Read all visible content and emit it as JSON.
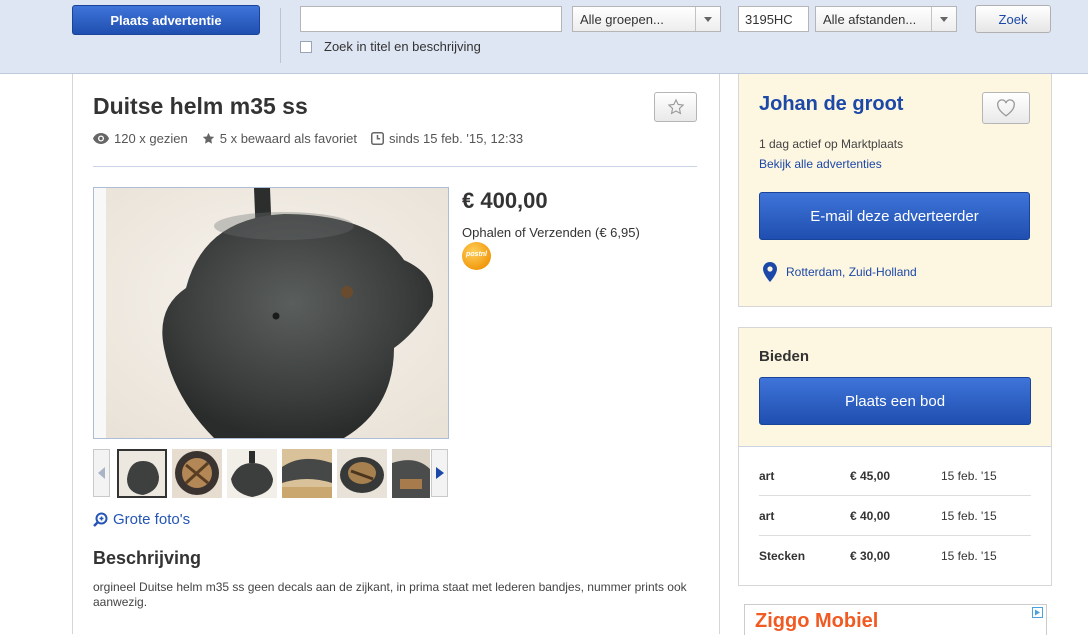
{
  "header": {
    "place_ad": "Plaats advertentie",
    "search_value": "",
    "groups_select": "Alle groepen...",
    "postcode": "3195HC",
    "distance_select": "Alle afstanden...",
    "search_button": "Zoek",
    "search_in_description": "Zoek in titel en beschrijving"
  },
  "listing": {
    "title": "Duitse helm m35 ss",
    "views": "120 x gezien",
    "favorites": "5 x bewaard als favoriet",
    "since": "sinds 15 feb. '15, 12:33",
    "price": "€ 400,00",
    "delivery": "Ophalen of Verzenden (€ 6,95)",
    "postnl_logo": "postnl",
    "large_photos": "Grote foto's",
    "description_heading": "Beschrijving",
    "description": "orgineel Duitse helm m35 ss geen decals aan de zijkant, in prima staat met lederen bandjes, nummer prints ook aanwezig."
  },
  "seller": {
    "name": "Johan de groot",
    "active": "1 dag actief op Marktplaats",
    "all_ads": "Bekijk alle advertenties",
    "email_button": "E-mail deze adverteerder",
    "location": "Rotterdam, Zuid-Holland"
  },
  "bids": {
    "heading": "Bieden",
    "button": "Plaats een bod",
    "rows": [
      {
        "name": "art",
        "amount": "€ 45,00",
        "date": "15 feb. '15"
      },
      {
        "name": "art",
        "amount": "€ 40,00",
        "date": "15 feb. '15"
      },
      {
        "name": "Stecken",
        "amount": "€ 30,00",
        "date": "15 feb. '15"
      }
    ]
  },
  "ad": {
    "text": "Ziggo Mobiel"
  },
  "colors": {
    "accent": "#1c48a8",
    "header_bg": "#dfe6f3",
    "seller_bg": "#fdf6e0"
  }
}
